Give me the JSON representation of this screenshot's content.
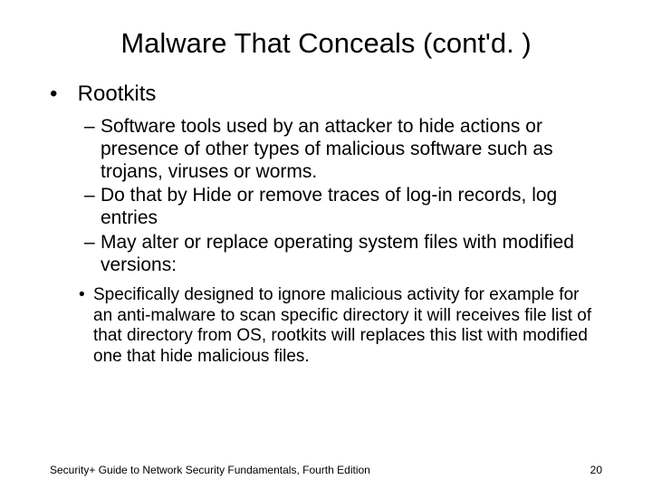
{
  "title": "Malware That Conceals (cont'd. )",
  "bullets": {
    "l1": "Rootkits",
    "l2a": "Software tools used by an attacker to hide actions or presence of other types of malicious software such as trojans, viruses or worms.",
    "l2b": "Do that by Hide or remove traces of log-in records, log entries",
    "l2c": "May alter or replace operating system files with modified versions:",
    "l3a": "Specifically designed to ignore malicious activity for example for an anti-malware to scan specific directory it will receives file list of that directory from OS, rootkits will replaces this list with modified one that hide malicious files."
  },
  "footer": {
    "left": "Security+ Guide to Network Security Fundamentals, Fourth Edition",
    "right": "20"
  }
}
